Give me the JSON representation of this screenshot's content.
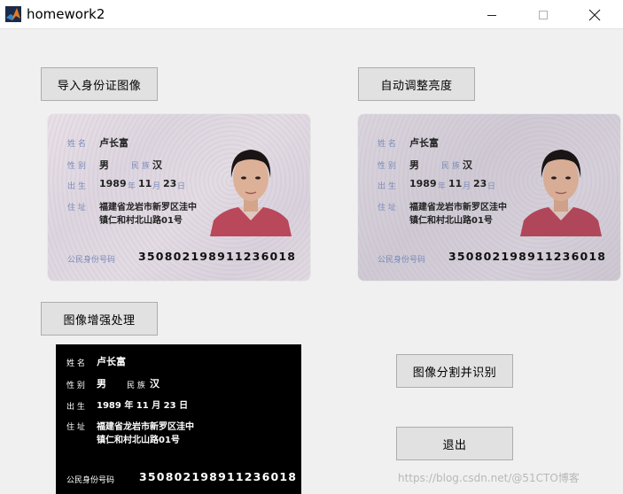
{
  "window": {
    "title": "homework2"
  },
  "buttons": {
    "import": "导入身份证图像",
    "auto_brightness": "自动调整亮度",
    "enhance": "图像增强处理",
    "segment": "图像分割并识别",
    "exit": "退出"
  },
  "id_card": {
    "name_label": "姓 名",
    "name": "卢长富",
    "sex_label": "性 别",
    "sex": "男",
    "ethnicity_label": "民 族",
    "ethnicity": "汉",
    "birth_label": "出 生",
    "birth_year": "1989",
    "year_label": "年",
    "birth_month": "11",
    "month_label": "月",
    "birth_day": "23",
    "day_label": "日",
    "address_label": "住 址",
    "address_line1": "福建省龙岩市新罗区洼中",
    "address_line2": "镇仁和村北山路01号",
    "id_label": "公民身份号码",
    "id_number": "350802198911236018"
  },
  "binary_card": {
    "name_label": "姓 名",
    "name": "卢长富",
    "sex_label": "性 别",
    "sex": "男",
    "ethnicity_label": "民 族",
    "ethnicity": "汉",
    "birth_label": "出 生",
    "birth": "1989 年 11 月 23 日",
    "address_label": "住 址",
    "address_line1": "福建省龙岩市新罗区洼中",
    "address_line2": "镇仁和村北山路01号",
    "id_label": "公民身份号码",
    "id_number": "350802198911236018"
  },
  "watermark": "https://blog.csdn.net/@51CTO博客",
  "colors": {
    "label_blue": "#7b8ab8",
    "button_face": "#e1e1e1",
    "window_bg": "#f0f0f0"
  }
}
